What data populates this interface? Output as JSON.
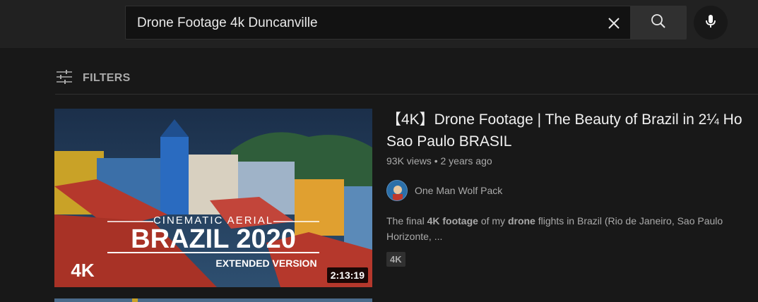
{
  "search": {
    "query": "Drone Footage 4k Duncanville"
  },
  "icons": {
    "clear": "close-icon",
    "search": "search-icon",
    "mic": "microphone-icon",
    "filters": "sliders-icon"
  },
  "filters": {
    "label": "FILTERS"
  },
  "results": [
    {
      "title_line1": "【4K】Drone Footage | The Beauty of Brazil in 2¼ Ho",
      "title_line2": "Sao Paulo BRASIL",
      "views": "93K views",
      "age": "2 years ago",
      "channel": "One Man Wolf Pack",
      "desc_prefix": "The final ",
      "desc_bold1": "4K footage",
      "desc_mid": " of my ",
      "desc_bold2": "drone",
      "desc_suffix": " flights in Brazil (Rio de Janeiro, Sao Paulo",
      "desc_line2": "Horizonte, ...",
      "badge": "4K",
      "duration": "2:13:19",
      "thumb_text": {
        "line1": "CINEMATIC AERIAL",
        "line2": "BRAZIL 2020",
        "line3": "EXTENDED VERSION",
        "logo": "4K"
      }
    }
  ],
  "colors": {
    "background": "#181818",
    "topbar": "#212121",
    "text_primary": "#f1f1f1",
    "text_secondary": "#aaaaaa"
  }
}
